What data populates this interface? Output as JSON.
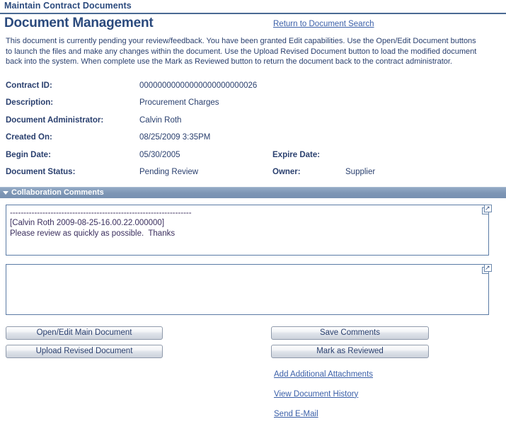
{
  "app": {
    "title": "Maintain Contract Documents"
  },
  "page": {
    "title": "Document Management",
    "return_link": "Return to Document Search",
    "instructions": "This document is currently pending your review/feedback.  You have been granted Edit capabilities.   Use the Open/Edit Document buttons\nto launch the files and make any changes within the document.   Use the Upload Revised Document button to load the modified document\nback into the system.   When complete use the Mark as Reviewed button to return the document back to the contract administrator."
  },
  "fields": {
    "contract_id_label": "Contract ID:",
    "contract_id_value": "00000000000000000000000026",
    "description_label": "Description:",
    "description_value": "Procurement Charges",
    "doc_admin_label": "Document Administrator:",
    "doc_admin_value": "Calvin Roth",
    "created_on_label": "Created On:",
    "created_on_value": "08/25/2009  3:35PM",
    "begin_date_label": "Begin Date:",
    "begin_date_value": "05/30/2005",
    "expire_date_label": "Expire Date:",
    "expire_date_value": "",
    "doc_status_label": "Document Status:",
    "doc_status_value": "Pending Review",
    "owner_label": "Owner:",
    "owner_value": "Supplier"
  },
  "collaboration": {
    "section_label": "Collaboration Comments",
    "existing_comments": "-------------------------------------------------------------------\n[Calvin Roth 2009-08-25-16.00.22.000000]\nPlease review as quickly as possible.  Thanks",
    "new_comment": "",
    "new_comment_placeholder": "",
    "expand_icon": "expand-icon"
  },
  "buttons": {
    "open_edit_main_document": "Open/Edit Main Document",
    "upload_revised_document": "Upload Revised Document",
    "save_comments": "Save Comments",
    "mark_as_reviewed": "Mark as Reviewed"
  },
  "links": {
    "add_additional_attachments": "Add Additional Attachments",
    "view_document_history": "View Document History",
    "send_email": "Send E-Mail"
  },
  "colors": {
    "text_navy": "#293F6E",
    "title_blue": "#2b4a7d",
    "link_blue": "#3a5fa8",
    "section_bar": "#7e96b5",
    "field_border": "#5b7ba5"
  }
}
